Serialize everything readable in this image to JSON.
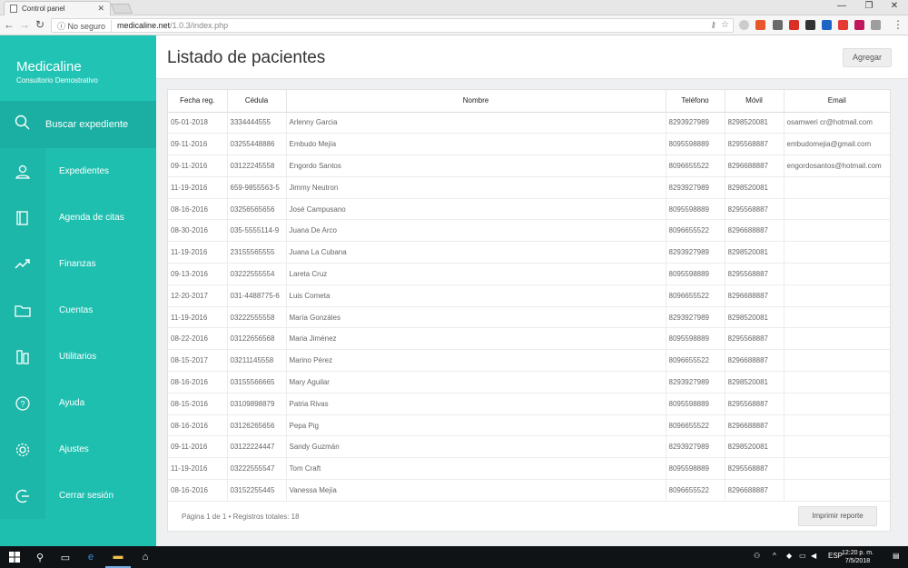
{
  "browser": {
    "tab_title": "Control panel",
    "tab_close": "✕",
    "security": "No seguro",
    "url_host": "medicaline.net",
    "url_path": "/1.0.3/index.php",
    "win_min": "—",
    "win_max": "❐",
    "win_close": "✕"
  },
  "brand": {
    "name_part1": "Medica",
    "name_part2": "line",
    "subtitle": "Consultorio Demostrativo"
  },
  "search": {
    "label": "Buscar expediente"
  },
  "nav": [
    {
      "label": "Expedientes",
      "icon": "user-icon"
    },
    {
      "label": "Agenda de citas",
      "icon": "notebook-icon"
    },
    {
      "label": "Finanzas",
      "icon": "trend-icon"
    },
    {
      "label": "Cuentas",
      "icon": "folder-icon"
    },
    {
      "label": "Utilitarios",
      "icon": "tools-icon"
    },
    {
      "label": "Ayuda",
      "icon": "help-icon"
    },
    {
      "label": "Ajustes",
      "icon": "gear-icon"
    },
    {
      "label": "Cerrar sesión",
      "icon": "logout-icon"
    }
  ],
  "page": {
    "title": "Listado de pacientes",
    "add_button": "Agregar"
  },
  "table": {
    "columns": [
      "Fecha reg.",
      "Cédula",
      "Nombre",
      "Teléfono",
      "Móvil",
      "Email"
    ],
    "rows": [
      [
        "05-01-2018",
        "3334444555",
        "Arlenny Garcia",
        "8293927989",
        "8298520081",
        "osamweri cr@hotmail.com"
      ],
      [
        "09-11-2016",
        "03255448886",
        "Embudo Mejía",
        "8095598889",
        "8295568887",
        "embudomejia@gmail.com"
      ],
      [
        "09-11-2016",
        "03122245558",
        "Engordo Santos",
        "8096655522",
        "8296688887",
        "engordosantos@hotmail.com"
      ],
      [
        "11-19-2016",
        "659-9855563-5",
        "Jimmy Neutron",
        "8293927989",
        "8298520081",
        ""
      ],
      [
        "08-16-2016",
        "03256565656",
        "José Campusano",
        "8095598889",
        "8295568887",
        ""
      ],
      [
        "08-30-2016",
        "035-5555114-9",
        "Juana De Arco",
        "8096655522",
        "8296688887",
        ""
      ],
      [
        "11-19-2016",
        "23155565555",
        "Juana La Cubana",
        "8293927989",
        "8298520081",
        ""
      ],
      [
        "09-13-2016",
        "03222555554",
        "Lareta Cruz",
        "8095598889",
        "8295568887",
        ""
      ],
      [
        "12-20-2017",
        "031-4488775-6",
        "Luis Cometa",
        "8096655522",
        "8296688887",
        ""
      ],
      [
        "11-19-2016",
        "03222555558",
        "María Gonzáles",
        "8293927989",
        "8298520081",
        ""
      ],
      [
        "08-22-2016",
        "03122656568",
        "Maria Jiménez",
        "8095598889",
        "8295568887",
        ""
      ],
      [
        "08-15-2017",
        "03211145558",
        "Marino Pérez",
        "8096655522",
        "8296688887",
        ""
      ],
      [
        "08-16-2016",
        "03155566665",
        "Mary Aguilar",
        "8293927989",
        "8298520081",
        ""
      ],
      [
        "08-15-2016",
        "03109898879",
        "Patria Rivas",
        "8095598889",
        "8295568887",
        ""
      ],
      [
        "08-16-2016",
        "03126265656",
        "Pepa Pig",
        "8096655522",
        "8296688887",
        ""
      ],
      [
        "09-11-2016",
        "03122224447",
        "Sandy Guzmán",
        "8293927989",
        "8298520081",
        ""
      ],
      [
        "11-19-2016",
        "03222555547",
        "Tom Craft",
        "8095598889",
        "8295568887",
        ""
      ],
      [
        "08-16-2016",
        "03152255445",
        "Vanessa Mejía",
        "8096655522",
        "8296688887",
        ""
      ]
    ]
  },
  "footer": {
    "info": "Página 1 de 1 • Registros totales: 18",
    "print_button": "Imprimir reporte"
  },
  "taskbar": {
    "language": "ESP",
    "time": "12:20 p. m.",
    "date": "7/5/2018"
  },
  "colors": {
    "sidebar": "#1fbfb0",
    "sidebar_search": "#1aafa2"
  }
}
